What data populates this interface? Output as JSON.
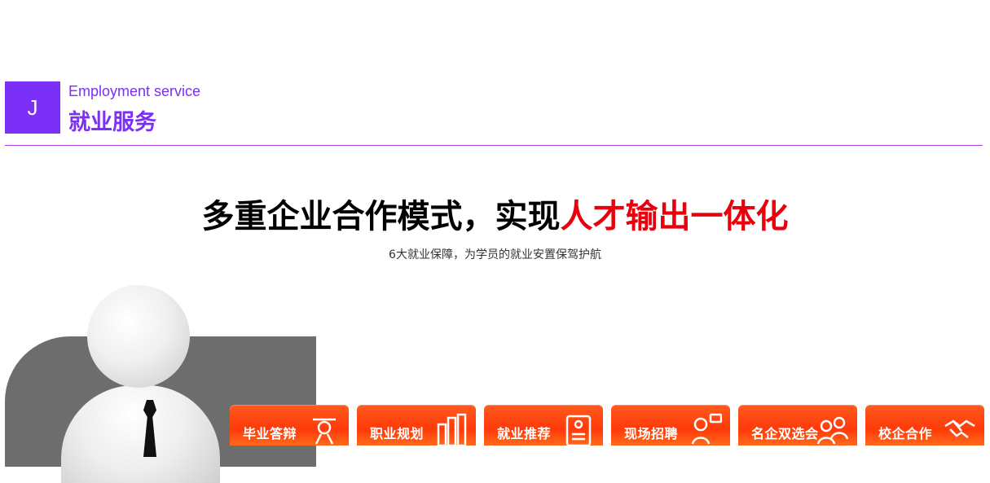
{
  "section": {
    "letter": "J",
    "en_title": "Employment service",
    "cn_title": "就业服务"
  },
  "headline": {
    "black_text": "多重企业合作模式，实现",
    "red_text": "人才输出一体化",
    "subline": "6大就业保障，为学员的就业安置保驾护航"
  },
  "services": [
    {
      "label": "毕业答辩",
      "icon": "graduation-icon"
    },
    {
      "label": "职业规划",
      "icon": "chart-bars-icon"
    },
    {
      "label": "就业推荐",
      "icon": "resume-icon"
    },
    {
      "label": "现场招聘",
      "icon": "job-interview-icon"
    },
    {
      "label": "名企双选会",
      "icon": "people-icon"
    },
    {
      "label": "校企合作",
      "icon": "handshake-icon"
    }
  ],
  "colors": {
    "accent_purple": "#7b2ff7",
    "headline_red": "#e8000c",
    "service_orange": "#ff3a0a"
  }
}
